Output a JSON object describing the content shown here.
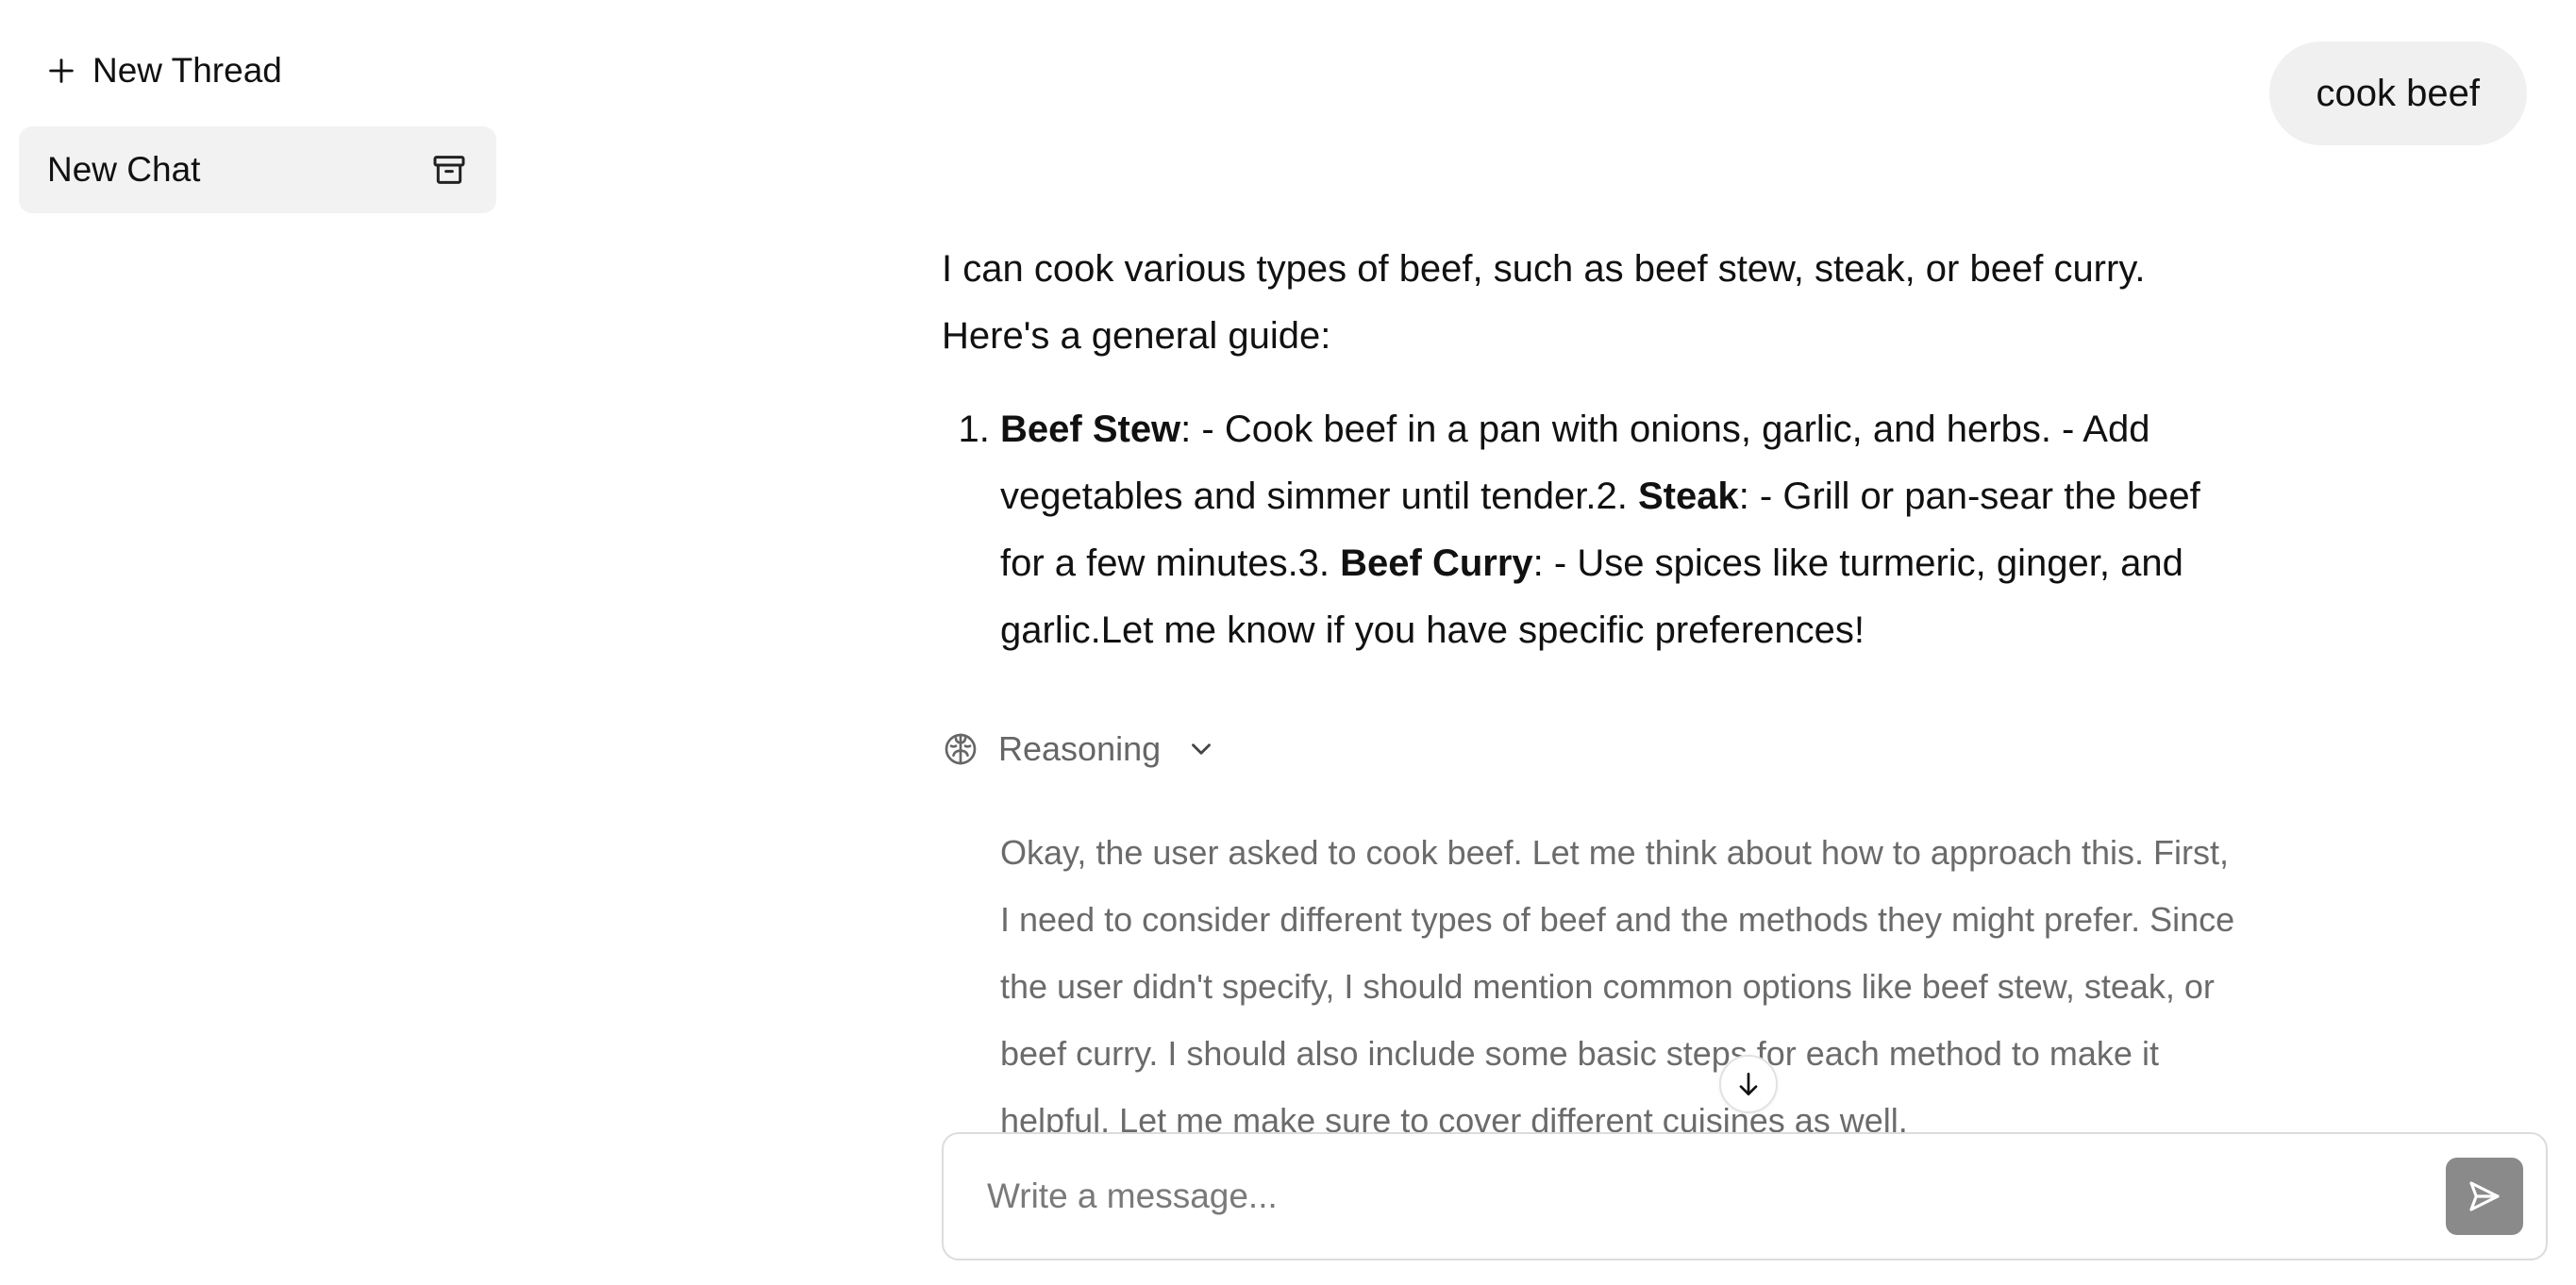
{
  "sidebar": {
    "new_thread_label": "New Thread",
    "threads": [
      {
        "label": "New Chat"
      }
    ]
  },
  "chat": {
    "user_message": "cook beef",
    "assistant_intro": "I can cook various types of beef, such as beef stew, steak, or beef curry. Here's a general guide:",
    "answer": {
      "item_number": "1.",
      "part1_bold": "Beef Stew",
      "part1_text": ": - Cook beef in a pan with onions, garlic, and herbs. - Add vegetables and simmer until tender.2. ",
      "part2_bold": "Steak",
      "part2_text": ": - Grill or pan-sear the beef for a few minutes.3. ",
      "part3_bold": "Beef Curry",
      "part3_text": ": - Use spices like turmeric, ginger, and garlic.Let me know if you have specific preferences!"
    },
    "reasoning": {
      "label": "Reasoning",
      "text": "Okay, the user asked to cook beef. Let me think about how to approach this. First, I need to consider different types of beef and the methods they might prefer. Since the user didn't specify, I should mention common options like beef stew, steak, or beef curry. I should also include some basic steps for each method to make it helpful. Let me make sure to cover different cuisines as well."
    }
  },
  "composer": {
    "placeholder": "Write a message..."
  },
  "icons": {
    "new_thread": "plus-icon",
    "archive": "archive-icon",
    "reasoning": "brain-icon",
    "expand": "chevron-down-icon",
    "scroll": "arrow-down-icon",
    "send": "send-icon"
  },
  "colors": {
    "thread_active_bg": "#f2f2f2",
    "user_bubble_bg": "#f0f0f0",
    "reasoning_text": "#6b6b6b",
    "send_button_bg": "#8a8a8a"
  }
}
